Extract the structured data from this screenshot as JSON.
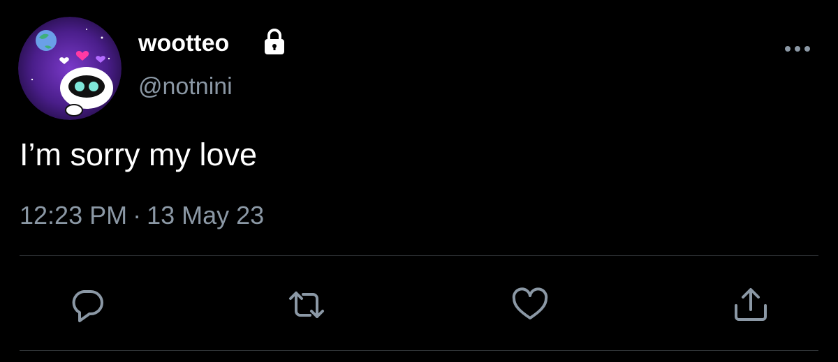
{
  "tweet": {
    "author": {
      "display_name": "wootteo",
      "handle": "@notnini",
      "protected_icon": "lock-icon",
      "avatar_icon": "robot-avatar"
    },
    "text": "I’m sorry my love",
    "time": "12:23 PM",
    "separator": "·",
    "date": "13 May 23"
  },
  "header": {
    "more_icon": "more-horizontal-icon"
  },
  "actions": [
    {
      "name": "reply",
      "icon": "reply-icon"
    },
    {
      "name": "retweet",
      "icon": "retweet-icon"
    },
    {
      "name": "like",
      "icon": "heart-icon"
    },
    {
      "name": "share",
      "icon": "share-icon"
    }
  ],
  "colors": {
    "background": "#000000",
    "primary_text": "#ffffff",
    "secondary_text": "#8b98a5",
    "divider": "#2f3336",
    "icon": "#8b98a5"
  }
}
